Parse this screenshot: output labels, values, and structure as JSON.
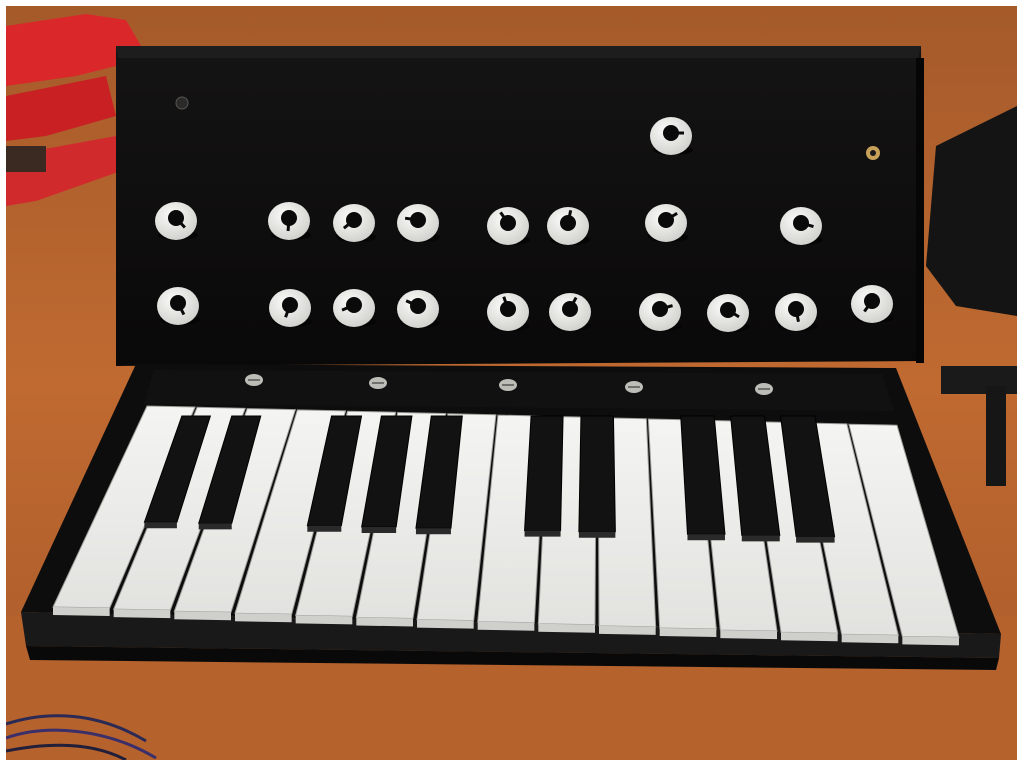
{
  "image": {
    "subject": "synthesizer",
    "colors": {
      "desk": "#b8652f",
      "desk_dark": "#8d4620",
      "panel": "#0d0c0c",
      "knob_cap": "#e9e9e6",
      "knob_core": "#0a0a0a",
      "white_key": "#eeeeec",
      "black_key": "#121212",
      "toy": "#d8282b"
    },
    "knobs": {
      "top_single": 1,
      "middle_row": 8,
      "bottom_row": 10
    },
    "keys": {
      "white": 15,
      "black": 10
    },
    "screws": 5
  }
}
